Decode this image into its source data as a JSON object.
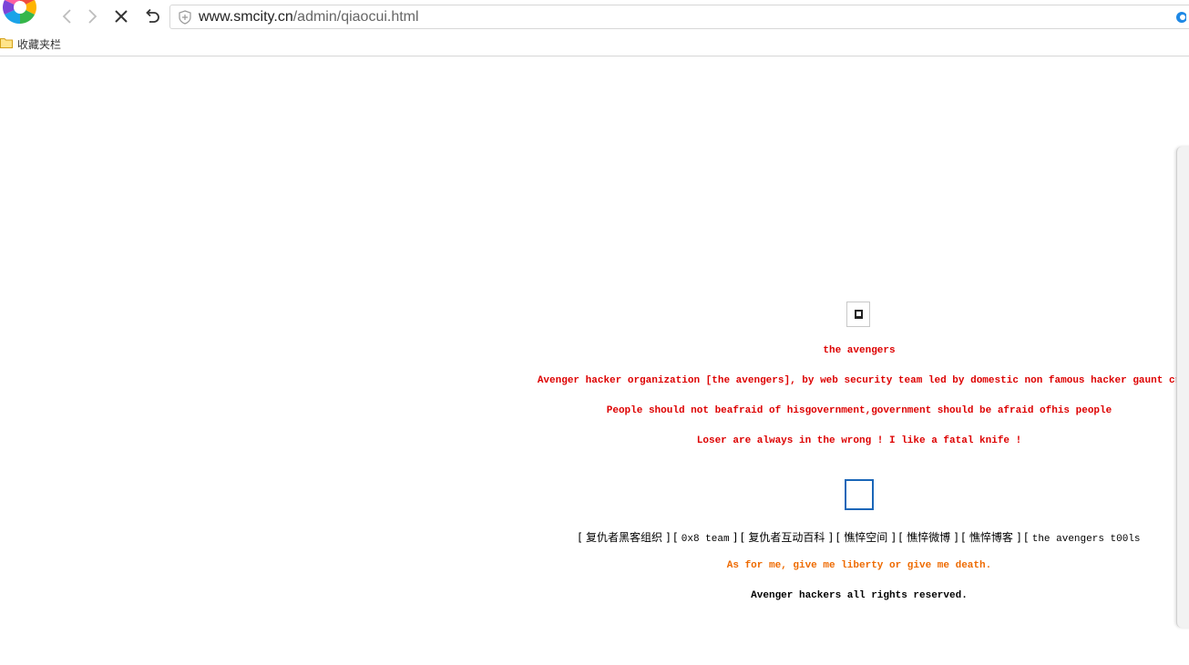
{
  "browser": {
    "url_host": "www.smcity.cn",
    "url_path": "/admin/qiaocui.html",
    "bookmarks_label": "收藏夹栏"
  },
  "page": {
    "title": "the avengers",
    "line1": "Avenger hacker organization [the avengers], by web security team led by domestic non famous hacker gaunt cr",
    "line2": "People should not beafraid of hisgovernment,government should be afraid ofhis people",
    "line3": "Loser are always in the wrong ! I like a fatal knife !",
    "links": [
      {
        "text": "复仇者黑客组织",
        "mono": false
      },
      {
        "text": "0x8 team",
        "mono": true
      },
      {
        "text": "复仇者互动百科",
        "mono": false
      },
      {
        "text": "憔悴空间",
        "mono": false
      },
      {
        "text": "憔悴微博",
        "mono": false
      },
      {
        "text": "憔悴博客",
        "mono": false
      },
      {
        "text": "the avengers t00ls",
        "mono": true
      }
    ],
    "quote": "As for me, give me liberty or give me death.",
    "footer": "Avenger hackers all rights reserved.",
    "colors": {
      "red": "#dd0000",
      "orange": "#ee6a00",
      "black": "#000000"
    }
  }
}
